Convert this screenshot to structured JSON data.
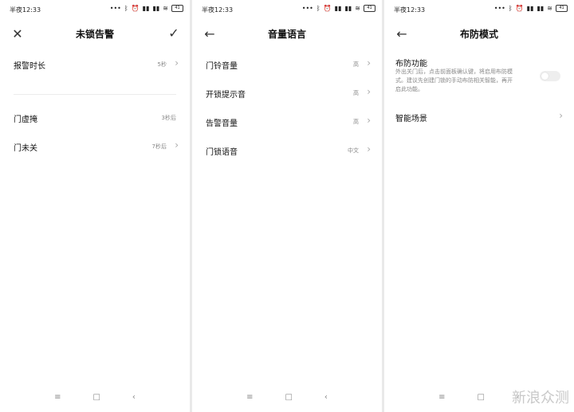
{
  "status_time": "半夜12:33",
  "status_batt": "41",
  "screens": {
    "s1": {
      "title": "未锁告警",
      "rows": [
        {
          "label": "报警时长",
          "value": "5秒"
        },
        {
          "label": "门虚掩",
          "value": "3秒后"
        },
        {
          "label": "门未关",
          "value": "7秒后"
        }
      ]
    },
    "s2": {
      "title": "音量语言",
      "rows": [
        {
          "label": "门铃音量",
          "value": "高"
        },
        {
          "label": "开锁提示音",
          "value": "高"
        },
        {
          "label": "告警音量",
          "value": "高"
        },
        {
          "label": "门锁语音",
          "value": "中文"
        }
      ]
    },
    "s3": {
      "title": "布防模式",
      "feature_title": "布防功能",
      "feature_desc": "外出关门后，点击前面板确认键，将启用布防模式。建议先创建门锁的手动布防相关智能，再开启此功能。",
      "toggle_on": false,
      "row_label": "智能场景"
    }
  },
  "icons": {
    "close": "close-icon",
    "check": "check-icon",
    "back": "back-arrow-icon",
    "chevron": "chevron-right-icon",
    "nav_menu": "menu-icon",
    "nav_home": "home-icon",
    "nav_back": "nav-back-icon"
  },
  "watermark": "新浪众测"
}
